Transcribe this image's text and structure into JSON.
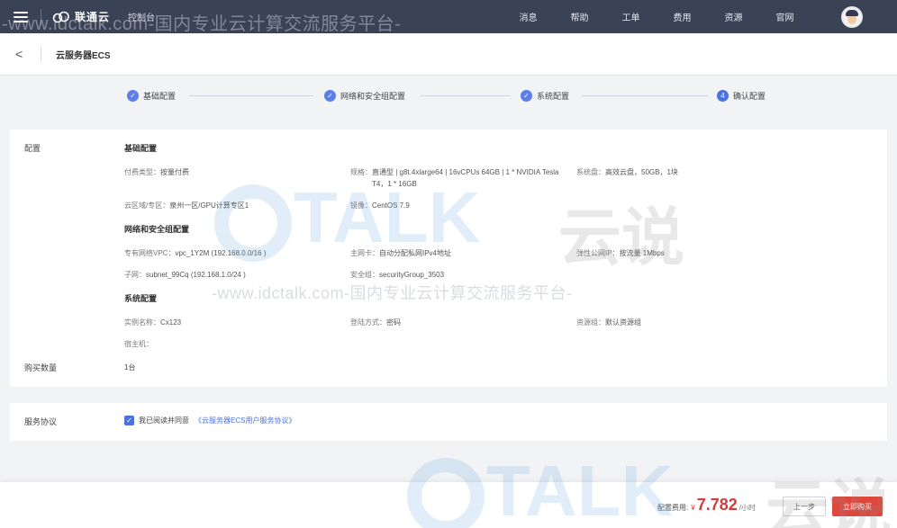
{
  "topnav": {
    "brand": "联通云",
    "console": "控制台",
    "links": [
      "消息",
      "帮助",
      "工单",
      "费用",
      "资源",
      "官网"
    ]
  },
  "header": {
    "back": "<",
    "title": "云服务器ECS"
  },
  "steps": [
    {
      "label": "基础配置",
      "state": "done",
      "marker": "✓"
    },
    {
      "label": "网络和安全组配置",
      "state": "done",
      "marker": "✓"
    },
    {
      "label": "系统配置",
      "state": "done",
      "marker": "✓"
    },
    {
      "label": "确认配置",
      "state": "current",
      "marker": "4"
    }
  ],
  "config": {
    "side_label": "配置",
    "basic": {
      "title": "基础配置",
      "billing_key": "付费类型：",
      "billing_value": "按量付费",
      "spec_key": "规格：",
      "spec_line1": "直通型 | g8t.4xlarge64 | 16vCPUs 64GB | 1 * NVIDIA Tesla",
      "spec_line2": "T4，1 * 16GB",
      "disk_key": "系统盘：",
      "disk_value": "高效云盘，50GB，1块",
      "region_key": "云区域/专区：",
      "region_value": "泉州一区/GPU计算专区1",
      "image_key": "镜像：",
      "image_value": "CentOS 7.9"
    },
    "network": {
      "title": "网络和安全组配置",
      "vpc_key": "专有网络VPC：",
      "vpc_value": "vpc_1Y2M (192.168.0.0/16 )",
      "nic_key": "主网卡：",
      "nic_value": "自动分配私网IPv4地址",
      "eip_key": "弹性公网IP：",
      "eip_value": "按流量 1Mbps",
      "subnet_key": "子网：",
      "subnet_value": "subnet_99Cq (192.168.1.0/24 )",
      "sg_key": "安全组：",
      "sg_value": "securityGroup_3503"
    },
    "system": {
      "title": "系统配置",
      "name_key": "实例名称：",
      "name_value": "Cx123",
      "login_key": "登陆方式：",
      "login_value": "密码",
      "rg_key": "资源组：",
      "rg_value": "默认资源组",
      "host_key": "宿主机："
    },
    "quantity_label": "购买数量",
    "quantity_value": "1台"
  },
  "agreement": {
    "label": "服务协议",
    "check": "✓",
    "text": "我已阅读并同意",
    "link": "《云服务器ECS用户服务协议》"
  },
  "footer": {
    "fee_label": "配置费用:",
    "currency": "¥",
    "price": "7.782",
    "unit": "/小时",
    "prev": "上一步",
    "buy": "立即购买"
  },
  "watermark": {
    "url_text": "-www.idctalk.com-国内专业云计算交流服务平台-",
    "logo_text": "TALK",
    "logo_cn": "云说"
  },
  "colors": {
    "nav_bg": "#3a4255",
    "accent": "#4d72de",
    "price": "#d63b3b",
    "buy_button": "#e0463c"
  }
}
